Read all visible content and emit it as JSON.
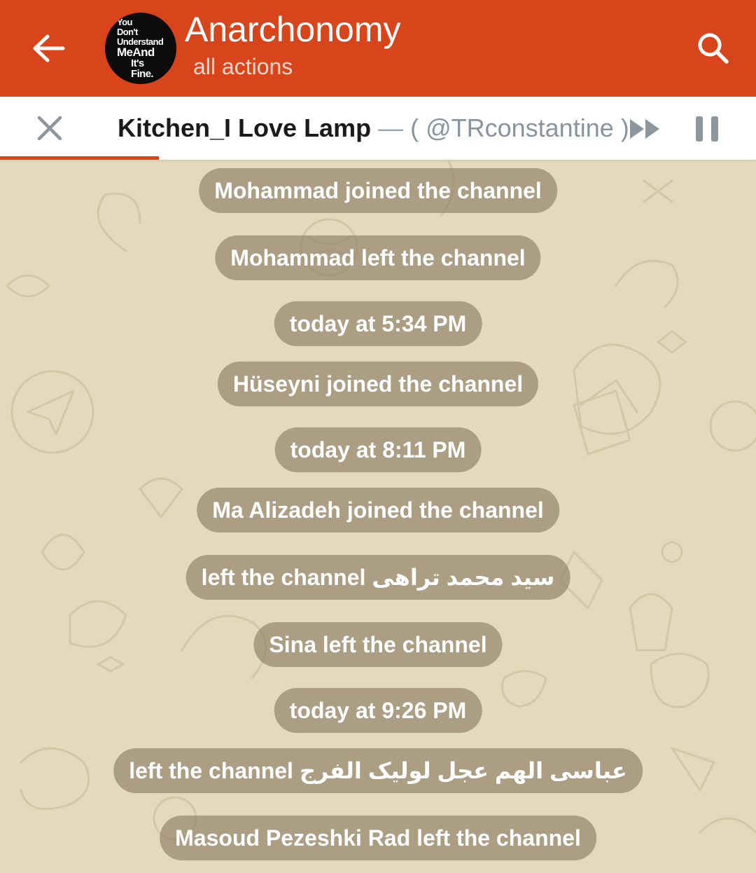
{
  "header": {
    "title": "Anarchonomy",
    "subtitle": "all actions",
    "avatar_lines": [
      "You",
      "Don't",
      "Understand",
      "MeAnd",
      "It's",
      "Fine."
    ]
  },
  "player": {
    "track_title": "Kitchen_I Love Lamp",
    "separator": " — ",
    "artist": "( @TRconstantine )",
    "progress_fraction": 0.21
  },
  "messages": [
    {
      "text": "Mohammad joined the channel"
    },
    {
      "text": "Mohammad left the channel"
    },
    {
      "text": "today at 5:34 PM"
    },
    {
      "text": "Hüseyni joined the channel"
    },
    {
      "text": "today at 8:11 PM"
    },
    {
      "text": "Ma Alizadeh joined the channel"
    },
    {
      "text": "left the channel سید محمد تراهی"
    },
    {
      "text": "Sina left the channel"
    },
    {
      "text": "today at 9:26 PM"
    },
    {
      "text": "left the channel عباسی الهم عجل لولیک الفرج"
    },
    {
      "text": "Masoud Pezeshki Rad left the channel"
    }
  ],
  "icons": {
    "back": "arrow-left-icon",
    "search": "search-icon",
    "close": "close-icon",
    "speed": "fast-forward-icon",
    "pause": "pause-icon"
  },
  "colors": {
    "header": "#d8451b",
    "background": "#e4d9bd",
    "bubble": "#96876c"
  }
}
